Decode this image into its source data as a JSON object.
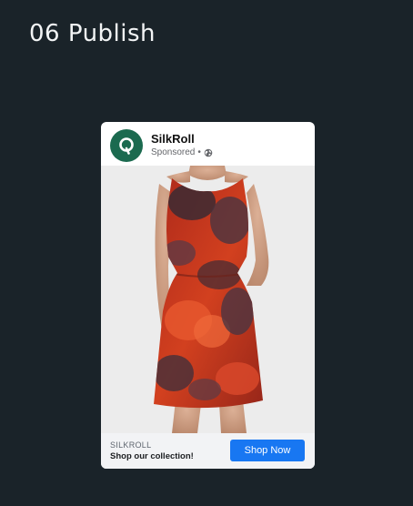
{
  "page": {
    "step_title": "06 Publish"
  },
  "ad": {
    "brand_name": "SilkRoll",
    "sponsored_label": "Sponsored",
    "separator": "•",
    "footer_domain": "SILKROLL",
    "footer_tagline": "Shop our collection!",
    "cta_label": "Shop Now",
    "avatar_icon": "q-logo-icon",
    "privacy_icon": "globe-icon"
  },
  "colors": {
    "page_background": "#1a2329",
    "avatar_background": "#1b6a4f",
    "cta_background": "#1877f2",
    "dress_primary": "#c9361b"
  }
}
